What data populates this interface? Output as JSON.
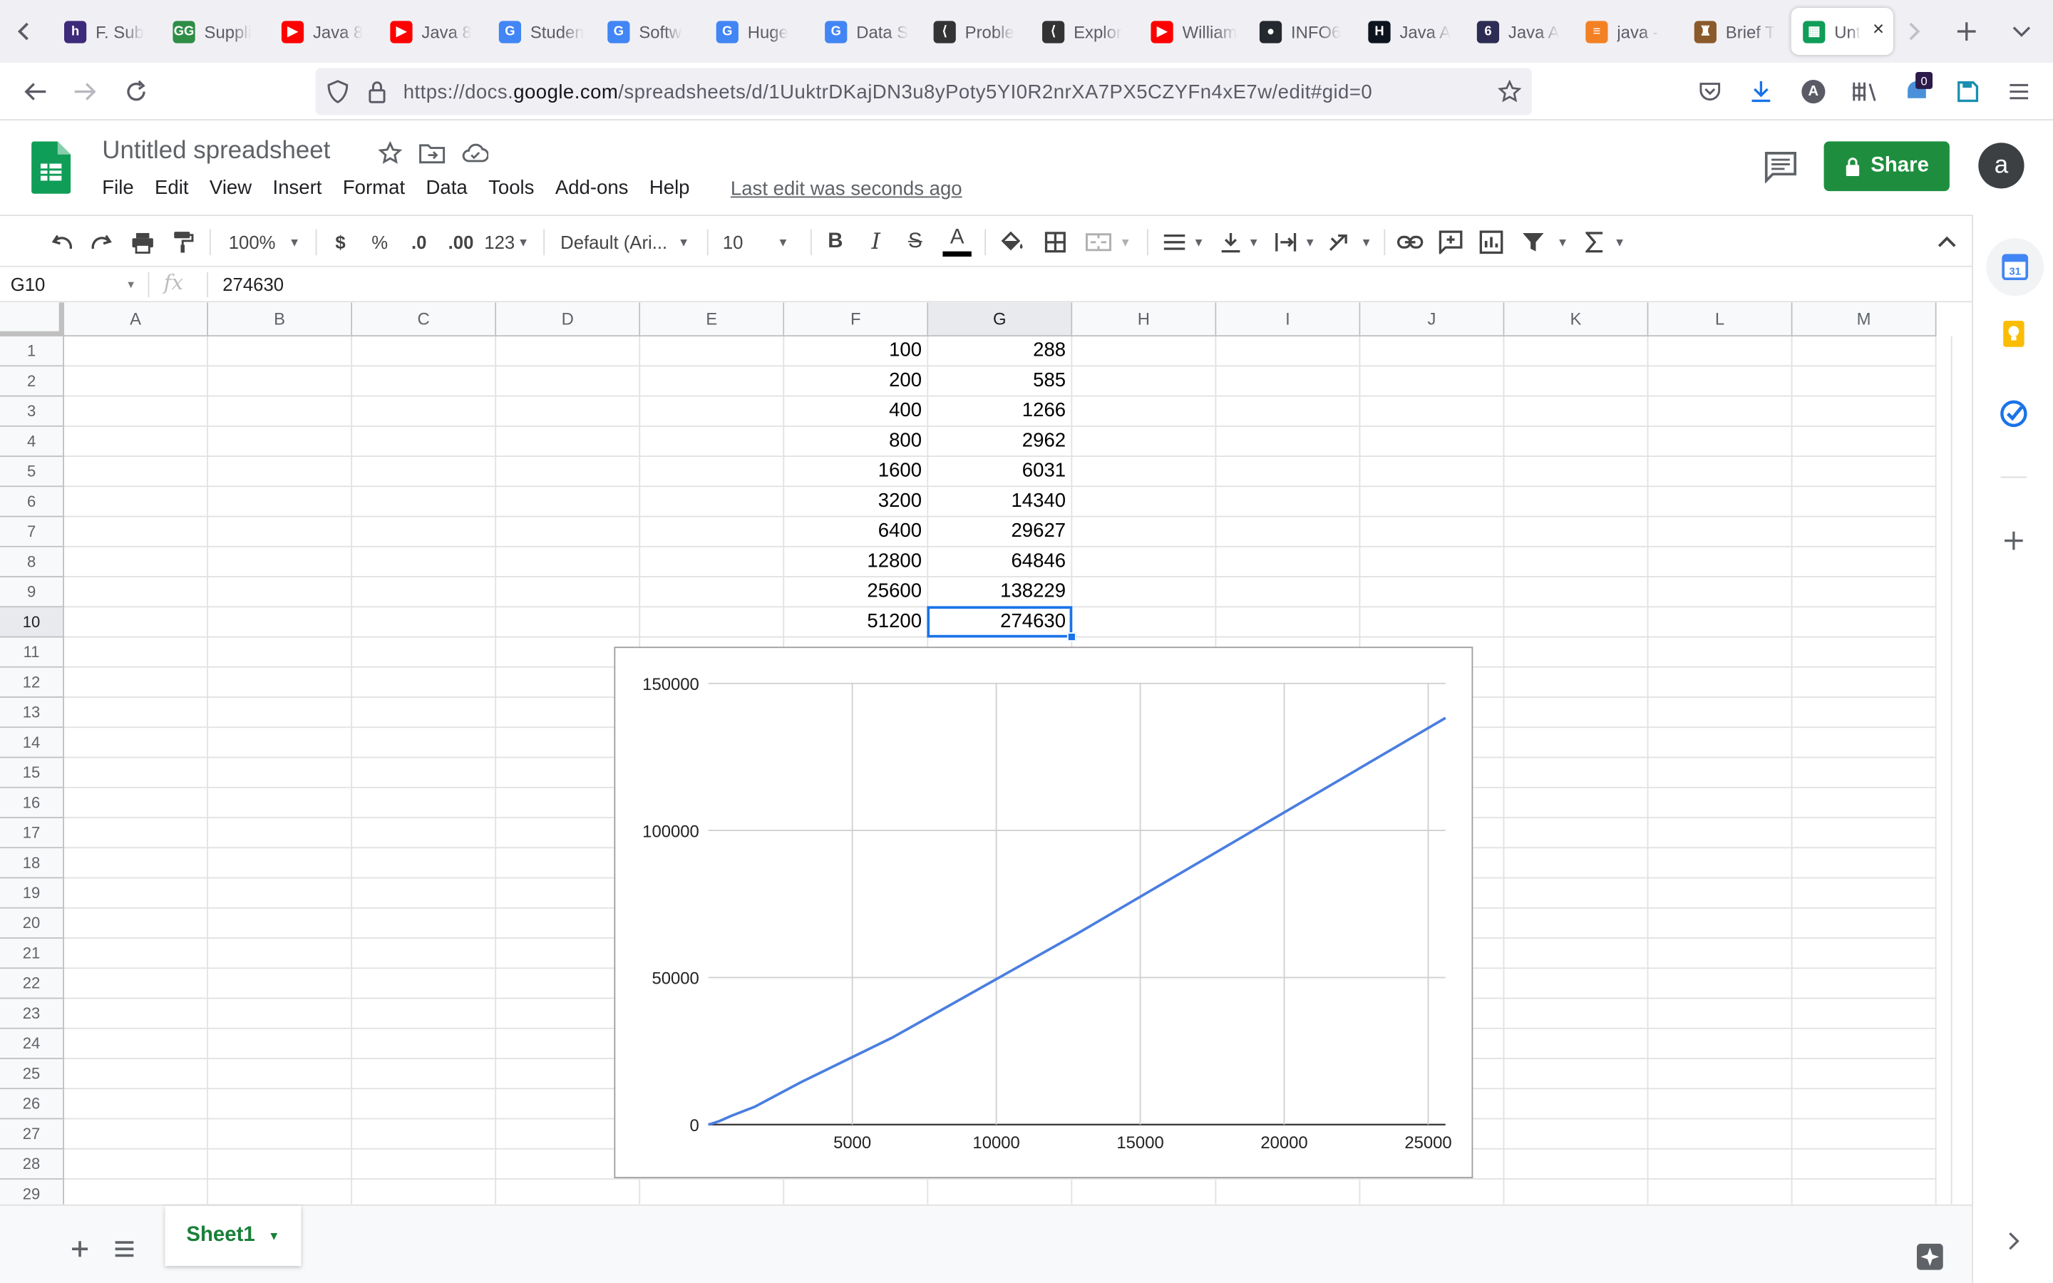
{
  "browser": {
    "tabs": [
      {
        "label": "F. Sub",
        "icon": "h-icon",
        "color": "#3d2a7a",
        "glyph": "h"
      },
      {
        "label": "Suppli",
        "icon": "gfg-icon",
        "color": "#2f8d46",
        "glyph": "GG"
      },
      {
        "label": "Java 8",
        "icon": "youtube-icon",
        "color": "#ff0000",
        "glyph": "▶"
      },
      {
        "label": "Java 8",
        "icon": "youtube-icon",
        "color": "#ff0000",
        "glyph": "▶"
      },
      {
        "label": "Studen",
        "icon": "google-icon",
        "color": "#4285f4",
        "glyph": "G"
      },
      {
        "label": "Softw",
        "icon": "google-icon",
        "color": "#4285f4",
        "glyph": "G"
      },
      {
        "label": "Huge",
        "icon": "google-icon",
        "color": "#4285f4",
        "glyph": "G"
      },
      {
        "label": "Data S",
        "icon": "google-icon",
        "color": "#4285f4",
        "glyph": "G"
      },
      {
        "label": "Proble",
        "icon": "leetcode-icon",
        "color": "#333333",
        "glyph": "⟨"
      },
      {
        "label": "Explor",
        "icon": "leetcode-icon",
        "color": "#333333",
        "glyph": "⟨"
      },
      {
        "label": "William",
        "icon": "youtube-icon",
        "color": "#ff0000",
        "glyph": "▶"
      },
      {
        "label": "INFO6",
        "icon": "github-icon",
        "color": "#24292f",
        "glyph": "●"
      },
      {
        "label": "Java A",
        "icon": "hackerrank-icon",
        "color": "#0e141e",
        "glyph": "H"
      },
      {
        "label": "Java A",
        "icon": "baeldung-icon",
        "color": "#2c2c54",
        "glyph": "6"
      },
      {
        "label": "java -",
        "icon": "stackoverflow-icon",
        "color": "#f48024",
        "glyph": "≡"
      },
      {
        "label": "Brief T",
        "icon": "shield-crest-icon",
        "color": "#8b5a2b",
        "glyph": "♜"
      }
    ],
    "active_tab": {
      "label": "Unt",
      "close": "×",
      "color": "#0f9d58"
    },
    "url_prefix": "https://docs.",
    "url_domain": "google.com",
    "url_path": "/spreadsheets/d/1UuktrDKajDN3u8yPoty5YI0R2nrXA7PX5CZYFn4xE7w/edit#gid=0",
    "notification_count": "0"
  },
  "app": {
    "title": "Untitled spreadsheet",
    "menu": [
      "File",
      "Edit",
      "View",
      "Insert",
      "Format",
      "Data",
      "Tools",
      "Add-ons",
      "Help"
    ],
    "last_edit": "Last edit was seconds ago",
    "share_label": "Share",
    "avatar_letter": "a",
    "brand_color": "#1e8e3e"
  },
  "toolbar": {
    "zoom": "100%",
    "currency": "$",
    "percent": "%",
    "decrease_decimal": ".0",
    "increase_decimal": ".00",
    "format_more": "123",
    "font": "Default (Ari...",
    "font_size": "10",
    "bold": "B",
    "italic": "I",
    "strike": "S",
    "text_color": "A"
  },
  "formula_bar": {
    "cell_ref": "G10",
    "fx": "fx",
    "value": "274630"
  },
  "grid": {
    "columns": [
      "A",
      "B",
      "C",
      "D",
      "E",
      "F",
      "G",
      "H",
      "I",
      "J",
      "K",
      "L",
      "M"
    ],
    "rows": [
      "1",
      "2",
      "3",
      "4",
      "5",
      "6",
      "7",
      "8",
      "9",
      "10",
      "11",
      "12",
      "13",
      "14",
      "15",
      "16",
      "17",
      "18",
      "19",
      "20",
      "21",
      "22",
      "23",
      "24",
      "25",
      "26",
      "27",
      "28",
      "29"
    ],
    "selected_cell": "G10",
    "data": [
      {
        "F": "100",
        "G": "288"
      },
      {
        "F": "200",
        "G": "585"
      },
      {
        "F": "400",
        "G": "1266"
      },
      {
        "F": "800",
        "G": "2962"
      },
      {
        "F": "1600",
        "G": "6031"
      },
      {
        "F": "3200",
        "G": "14340"
      },
      {
        "F": "6400",
        "G": "29627"
      },
      {
        "F": "12800",
        "G": "64846"
      },
      {
        "F": "25600",
        "G": "138229"
      },
      {
        "F": "51200",
        "G": "274630"
      }
    ]
  },
  "chart_data": {
    "type": "line",
    "x": [
      100,
      200,
      400,
      800,
      1600,
      3200,
      6400,
      12800,
      25600
    ],
    "series": [
      {
        "values": [
          288,
          585,
          1266,
          2962,
          6031,
          14340,
          29627,
          64846,
          138229
        ],
        "color": "#4a7ee0"
      }
    ],
    "x_ticks": [
      "5000",
      "10000",
      "15000",
      "20000",
      "25000"
    ],
    "y_ticks": [
      "0",
      "50000",
      "100000",
      "150000"
    ],
    "xlim": [
      0,
      25600
    ],
    "ylim": [
      0,
      150000
    ],
    "grid": true,
    "title": "",
    "xlabel": "",
    "ylabel": ""
  },
  "sheets": {
    "active": "Sheet1"
  }
}
